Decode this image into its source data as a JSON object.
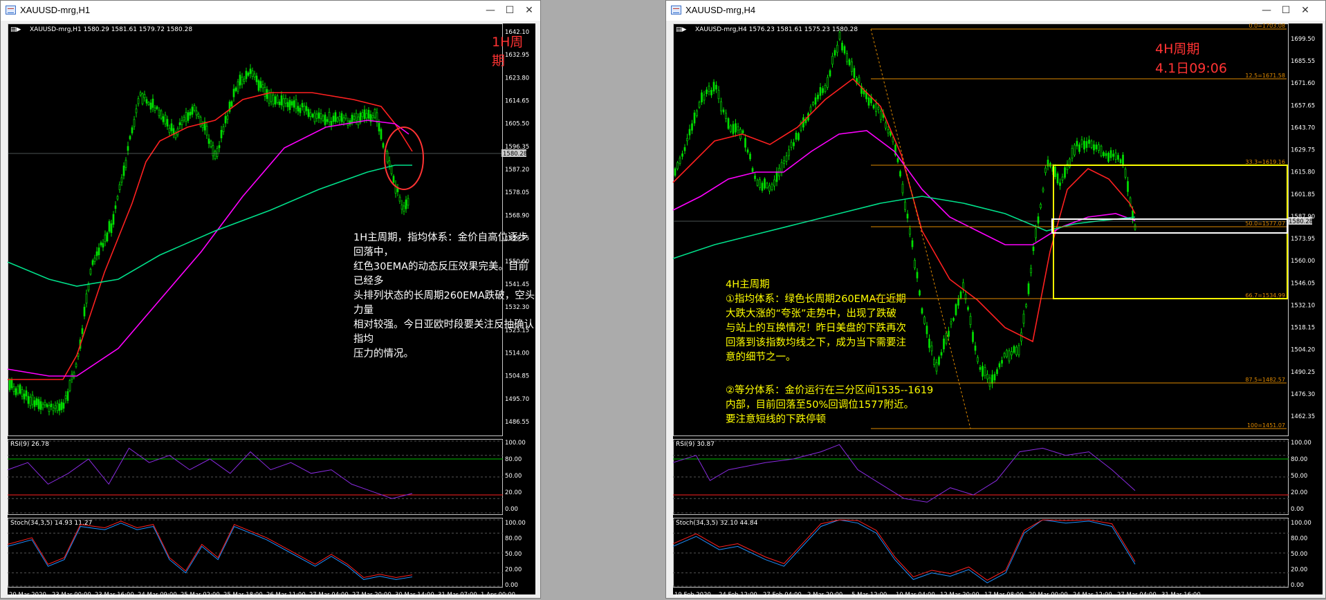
{
  "left_window": {
    "title": "XAUUSD-mrg,H1",
    "header_line": "XAUUSD-mrg,H1  1580.29 1581.61 1579.72 1580.28",
    "period_label": "1H周期",
    "current_price_tag": "1580.28",
    "price_ticks": [
      "1642.10",
      "1632.95",
      "1623.80",
      "1614.65",
      "1605.50",
      "1596.35",
      "1587.20",
      "1578.05",
      "1568.90",
      "1559.75",
      "1550.60",
      "1541.45",
      "1532.30",
      "1523.15",
      "1514.00",
      "1504.85",
      "1495.70",
      "1486.55"
    ],
    "annotation": "1H主周期，指均体系：金价自高位逐步回落中，\n红色30EMA的动态反压效果完美。目前已经多\n头排列状态的长周期260EMA跌破，空头力量\n相对较强。今日亚欧时段要关注反抽确认指均\n压力的情况。",
    "rsi_label": "RSI(9) 26.78",
    "rsi_ticks": [
      "100.00",
      "80.00",
      "50.00",
      "20.00",
      "0.00"
    ],
    "stoch_label": "Stoch(34,3,5) 14.93 11.27",
    "stoch_ticks": [
      "100.00",
      "80.00",
      "50.00",
      "20.00",
      "0.00"
    ],
    "time_ticks": [
      "20 Mar 2020",
      "23 Mar 00:00",
      "23 Mar 16:00",
      "24 Mar 09:00",
      "25 Mar 02:00",
      "25 Mar 18:00",
      "26 Mar 11:00",
      "27 Mar 04:00",
      "27 Mar 20:00",
      "30 Mar 14:00",
      "31 Mar 07:00",
      "1 Apr 00:00"
    ]
  },
  "right_window": {
    "title": "XAUUSD-mrg,H4",
    "header_line": "XAUUSD-mrg,H4  1576.23 1581.61 1575.23 1580.28",
    "period_label": "4H周期",
    "date_label": "4.1日09:06",
    "current_price_tag": "1580.28",
    "price_ticks": [
      "1699.50",
      "1685.55",
      "1671.60",
      "1657.65",
      "1643.70",
      "1629.75",
      "1615.80",
      "1601.85",
      "1587.90",
      "1573.95",
      "1560.00",
      "1546.05",
      "1532.10",
      "1518.15",
      "1504.20",
      "1490.25",
      "1476.30",
      "1462.35"
    ],
    "fib_levels": [
      "0.0=1703.08",
      "12.5=1671.58",
      "33.3=1619.16",
      "50.0=1577.07",
      "66.7=1534.99",
      "87.5=1482.57",
      "100=1451.07"
    ],
    "annotation_title": "4H主周期",
    "annotation_1": "①指均体系：绿色长周期260EMA在近期\n大跌大涨的“夸张”走势中，出现了跌破\n与站上的互换情况！昨日美盘的下跌再次\n回落到该指数均线之下，成为当下需要注\n意的细节之一。",
    "annotation_2": "②等分体系：金价运行在三分区间1535--1619\n内部，目前回落至50%回调位1577附近。\n要注意短线的下跌停顿",
    "rsi_label": "RSI(9) 30.87",
    "rsi_ticks": [
      "100.00",
      "80.00",
      "50.00",
      "20.00",
      "0.00"
    ],
    "stoch_label": "Stoch(34,3,5) 32.10 44.84",
    "stoch_ticks": [
      "100.00",
      "80.00",
      "50.00",
      "20.00",
      "0.00"
    ],
    "time_ticks": [
      "19 Feb 2020",
      "24 Feb 12:00",
      "27 Feb 04:00",
      "2 Mar 20:00",
      "5 Mar 12:00",
      "10 Mar 04:00",
      "12 Mar 20:00",
      "17 Mar 08:00",
      "20 Mar 00:00",
      "24 Mar 12:00",
      "27 Mar 04:00",
      "31 Mar 16:00"
    ]
  },
  "window_controls": {
    "minimize": "—",
    "maximize": "☐",
    "close": "✕"
  },
  "colors": {
    "candles": "#00e000",
    "ema_red": "#ff2020",
    "ema_magenta": "#ff00ff",
    "ema_green": "#00e08a",
    "annotation_white": "#ffffff",
    "annotation_yellow": "#ffff00",
    "period_red": "#ff3333",
    "fib": "#e08a00",
    "rsi_line": "#8a2be2",
    "stoch_main": "#1e90ff",
    "stoch_signal": "#ff2020"
  }
}
